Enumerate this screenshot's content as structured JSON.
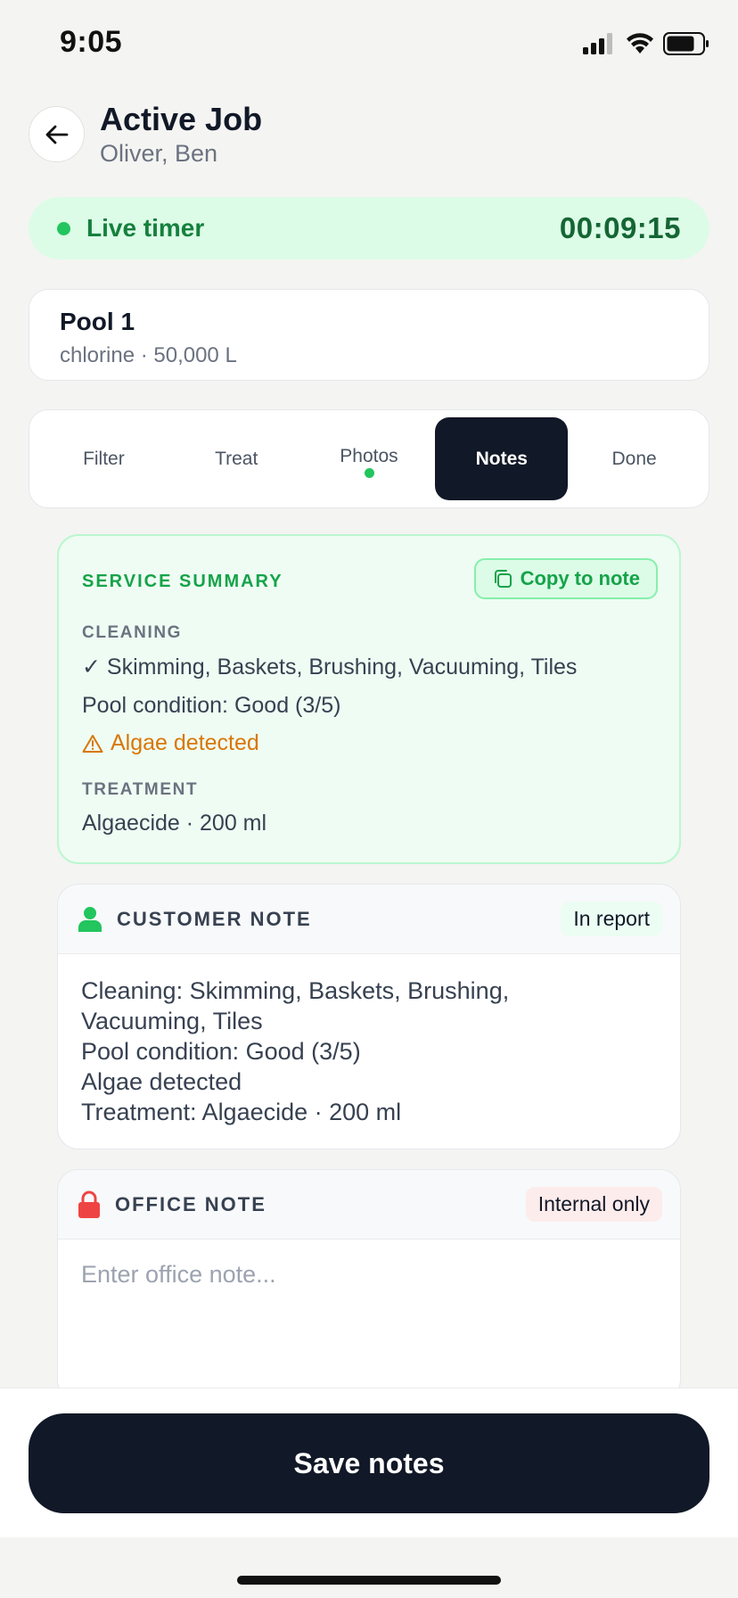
{
  "status_bar": {
    "time": "9:05"
  },
  "header": {
    "title": "Active Job",
    "subtitle": "Oliver, Ben"
  },
  "timer": {
    "label": "Live timer",
    "value": "00:09:15"
  },
  "pool": {
    "name": "Pool 1",
    "meta": "chlorine · 50,000 L"
  },
  "tabs": [
    {
      "label": "Filter",
      "active": false
    },
    {
      "label": "Treat",
      "active": false
    },
    {
      "label": "Photos",
      "active": false,
      "dot": true
    },
    {
      "label": "Notes",
      "active": true
    },
    {
      "label": "Done",
      "active": false
    }
  ],
  "summary": {
    "title": "SERVICE SUMMARY",
    "copy_label": "Copy to note",
    "cleaning_label": "CLEANING",
    "cleaning_items": "✓ Skimming, Baskets, Brushing, Vacuuming, Tiles",
    "condition": "Pool condition: Good (3/5)",
    "alert": "Algae detected",
    "treatment_label": "TREATMENT",
    "treatment": "Algaecide · 200 ml"
  },
  "customer_note": {
    "title": "CUSTOMER NOTE",
    "badge": "In report",
    "lines": [
      "Cleaning: Skimming, Baskets, Brushing,",
      "Vacuuming, Tiles",
      "Pool condition: Good (3/5)",
      "Algae detected",
      "Treatment: Algaecide · 200 ml"
    ]
  },
  "office_note": {
    "title": "OFFICE NOTE",
    "badge": "Internal only",
    "placeholder": "Enter office note..."
  },
  "save_label": "Save notes",
  "colors": {
    "accent_green": "#22c55e",
    "dark": "#111827",
    "alert_orange": "#d97706",
    "lock_red": "#ef4444"
  }
}
